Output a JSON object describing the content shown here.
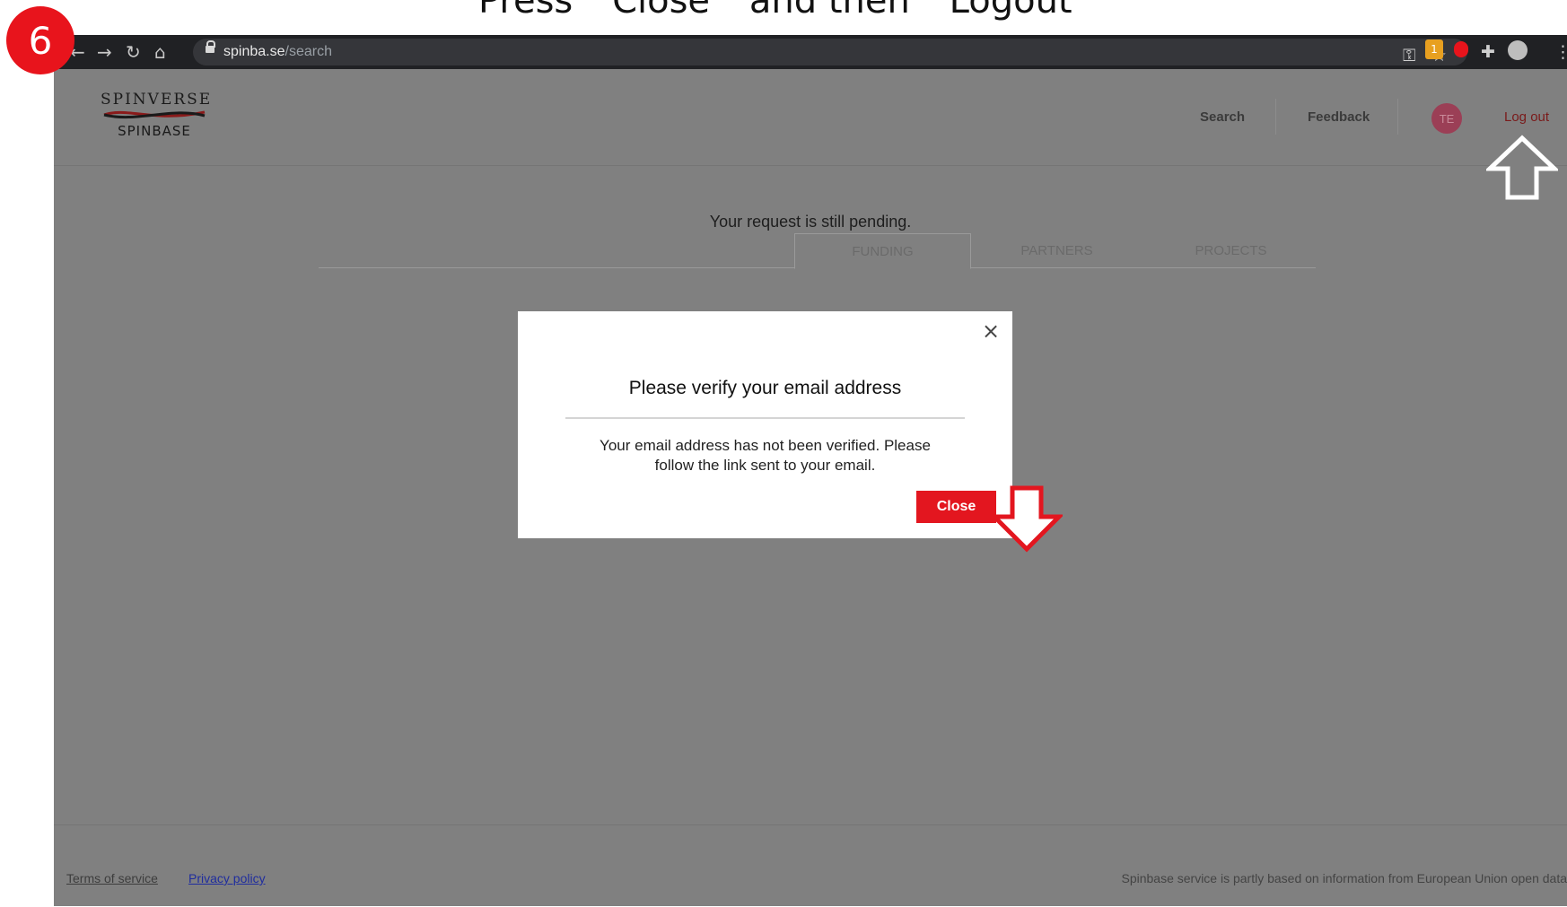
{
  "annotation": {
    "instruction": "Press  \"Close\"  and then  \"Logout\"",
    "step_number": "6",
    "colors": {
      "badge": "#e8141c",
      "arrow_outline": "#e3161f",
      "arrow_up_fill": "#ffffff"
    }
  },
  "browser": {
    "url_host": "spinba.se",
    "url_path": "/search",
    "icons": [
      "back-icon",
      "forward-icon",
      "reload-icon",
      "home-icon",
      "lock-icon",
      "key-icon",
      "star-icon",
      "extension-icon",
      "profile-icon",
      "menu-icon"
    ],
    "extension_badge": "1"
  },
  "header": {
    "logo_top": "SPINVERSE",
    "logo_bottom": "SPINBASE",
    "nav": {
      "search": "Search",
      "feedback": "Feedback"
    },
    "avatar_initials": "TE",
    "logout": "Log out"
  },
  "main": {
    "pending_message": "Your request is still pending.",
    "tabs": [
      "FUNDING",
      "PARTNERS",
      "PROJECTS"
    ],
    "active_tab": "FUNDING"
  },
  "modal": {
    "title": "Please verify your email address",
    "body": "Your email address has not been verified. Please follow the link sent to your email.",
    "close_label": "Close",
    "close_icon": "×"
  },
  "footer": {
    "terms": "Terms of service",
    "privacy": "Privacy policy",
    "note": "Spinbase service is partly based on information from European Union open data"
  },
  "colors": {
    "overlay_page": "#808080",
    "brand_red": "#e3161f",
    "chrome_dark": "#202124"
  }
}
